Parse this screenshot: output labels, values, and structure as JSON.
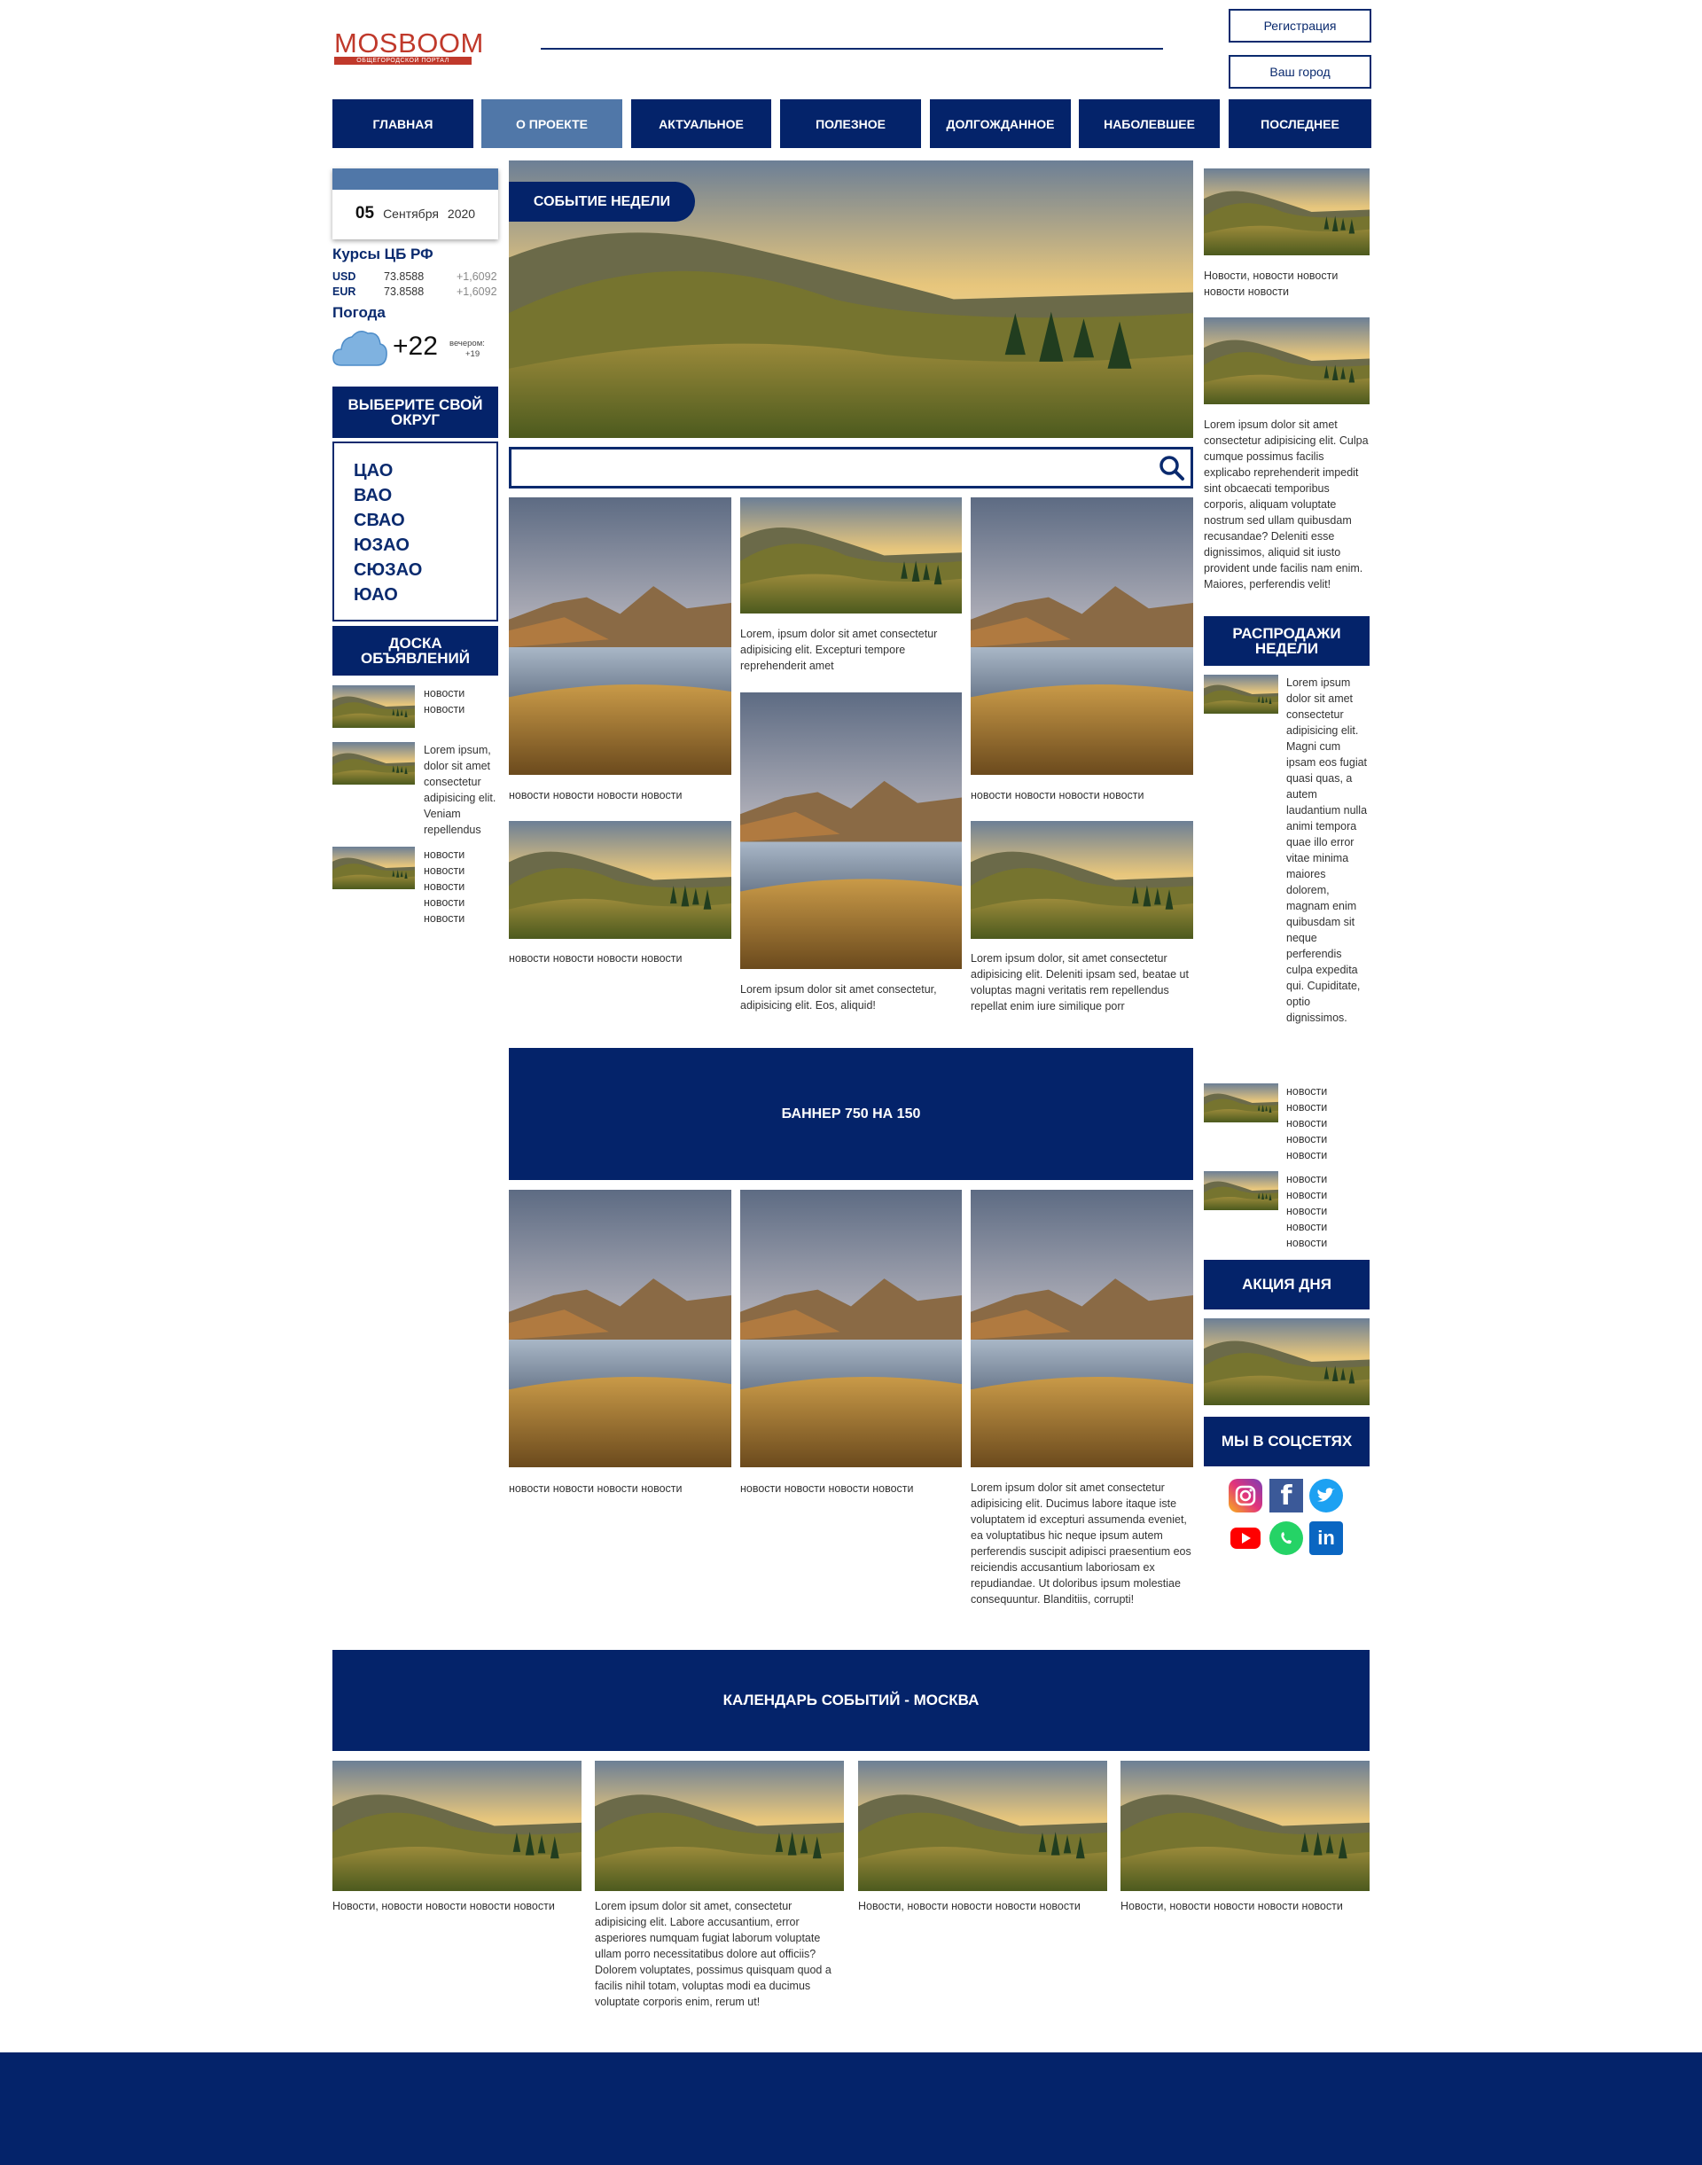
{
  "header": {
    "logo_main": "MOSBOOM",
    "logo_sub": "ОБЩЕГОРОДСКОЙ ПОРТАЛ",
    "register": "Регистрация",
    "city": "Ваш город"
  },
  "nav": [
    {
      "label": "ГЛАВНАЯ"
    },
    {
      "label": "О ПРОЕКТЕ"
    },
    {
      "label": "АКТУАЛЬНОЕ"
    },
    {
      "label": "ПОЛЕЗНОЕ"
    },
    {
      "label": "ДОЛГОЖДАННОЕ"
    },
    {
      "label": "НАБОЛЕВШЕЕ"
    },
    {
      "label": "ПОСЛЕДНЕЕ"
    }
  ],
  "calendar": {
    "day": "05",
    "month": "Сентября",
    "year": "2020"
  },
  "rates": {
    "title": "Курсы ЦБ РФ",
    "rows": [
      {
        "cur": "USD",
        "value": "73.8588",
        "change": "+1,6092"
      },
      {
        "cur": "EUR",
        "value": "73.8588",
        "change": "+1,6092"
      }
    ]
  },
  "weather": {
    "title": "Погода",
    "temp": "+22",
    "evening_label": "вечером:",
    "evening_temp": "+19"
  },
  "districts": {
    "title": "ВЫБЕРИТЕ СВОЙ ОКРУГ",
    "items": [
      "ЦАО",
      "ВАО",
      "СВАО",
      "ЮЗАО",
      "СЮЗАО",
      "ЮАО"
    ]
  },
  "board": {
    "title": "ДОСКА ОБЪЯВЛЕНИЙ",
    "items": [
      {
        "text": "новости новости"
      },
      {
        "text": "Lorem ipsum, dolor sit amet consectetur adipisicing elit. Veniam repellendus"
      },
      {
        "text": "новости новости новости новости новости"
      }
    ]
  },
  "event": {
    "badge": "СОБЫТИЕ НЕДЕЛИ"
  },
  "search": {
    "placeholder": ""
  },
  "grid1": {
    "c1a": "новости новости новости новости",
    "c1b": "новости новости новости новости",
    "c2a": "Lorem, ipsum dolor sit amet consectetur adipisicing elit. Excepturi tempore reprehenderit amet",
    "c2b": "Lorem ipsum dolor sit amet consectetur, adipisicing elit. Eos, aliquid!",
    "c3a": "новости новости новости новости",
    "c3b": "Lorem ipsum dolor, sit amet consectetur adipisicing elit. Deleniti ipsam sed, beatae ut voluptas magni veritatis rem repellendus repellat enim iure similique porr"
  },
  "banner": {
    "text": "БАННЕР 750 НА 150"
  },
  "grid2": {
    "c1": "новости новости новости новости",
    "c2": "новости новости новости новости",
    "c3": "Lorem ipsum dolor sit amet consectetur adipisicing elit. Ducimus labore itaque iste voluptatem id excepturi assumenda eveniet, ea voluptatibus hic neque ipsum autem perferendis suscipit adipisci praesentium eos reiciendis accusantium laboriosam ex repudiandae. Ut doloribus ipsum molestiae consequuntur. Blanditiis, corrupti!"
  },
  "right": {
    "n1": "Новости, новости новости новости новости",
    "n2": "Lorem ipsum dolor sit amet consectetur adipisicing elit. Culpa cumque possimus facilis explicabo reprehenderit impedit sint obcaecati temporibus corporis, aliquam voluptate nostrum sed ullam quibusdam recusandae? Deleniti esse dignissimos, aliquid sit iusto provident unde facilis nam enim. Maiores, perferendis velit!",
    "sales_title": "РАСПРОДАЖИ НЕДЕЛИ",
    "s1": "Lorem ipsum dolor sit amet consectetur adipisicing elit. Magni cum ipsam eos fugiat quasi quas, a autem laudantium nulla animi tempora quae illo error vitae minima maiores dolorem, magnam enim quibusdam sit neque perferendis culpa expedita qui. Cupiditate, optio dignissimos.",
    "s2": "новости новости новости новости новости",
    "s3": "новости новости новости новости новости",
    "promo_title": "АКЦИЯ ДНЯ",
    "social_title": "МЫ В СОЦСЕТЯХ"
  },
  "calendar_events": {
    "title": "КАЛЕНДАРЬ СОБЫТИЙ - МОСКВА",
    "items": [
      {
        "text": "Новости, новости новости новости новости"
      },
      {
        "text": "Lorem ipsum dolor sit amet, consectetur adipisicing elit. Labore accusantium, error asperiores numquam fugiat laborum voluptate ullam porro necessitatibus dolore aut officiis? Dolorem voluptates, possimus quisquam quod a facilis nihil totam, voluptas modi ea ducimus voluptate corporis enim, rerum ut!"
      },
      {
        "text": "Новости, новости новости новости новости"
      },
      {
        "text": "Новости, новости новости новости новости"
      }
    ]
  },
  "colors": {
    "navy": "#04236a",
    "nav_active": "#5077a8",
    "logo_red": "#c0392b"
  }
}
